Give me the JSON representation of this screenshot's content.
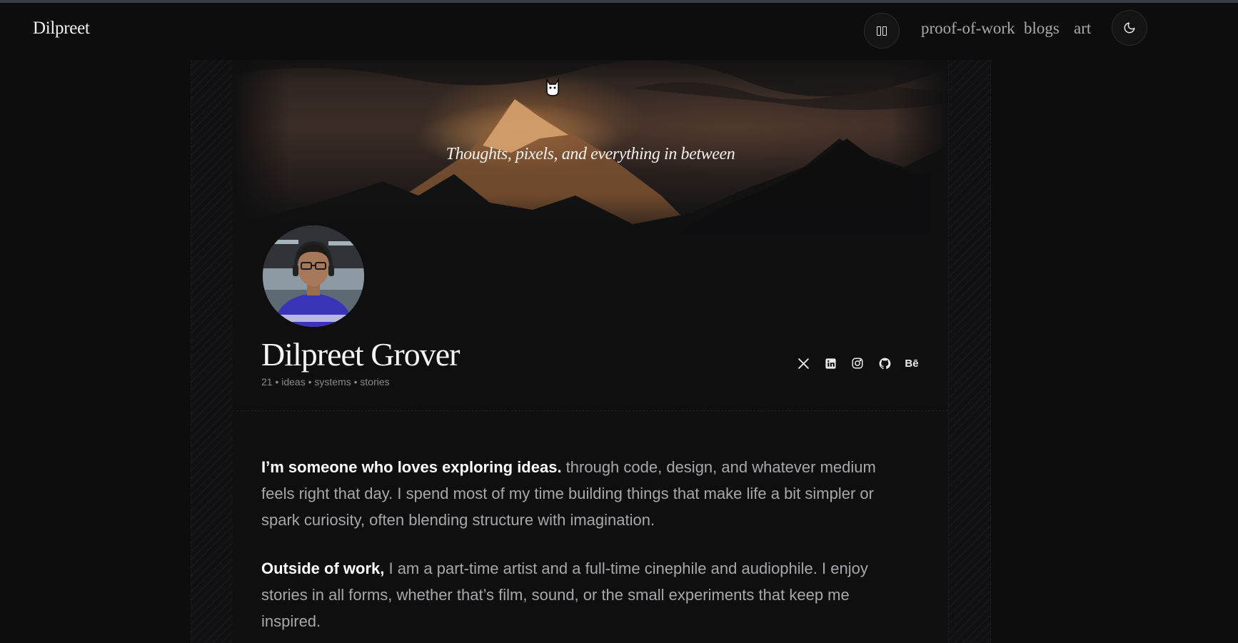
{
  "header": {
    "brand": "Dilpreet",
    "nav": [
      {
        "label": "proof-of-work"
      },
      {
        "label": "blogs"
      },
      {
        "label": "art"
      }
    ],
    "icons": {
      "music_toggle": "pause-icon",
      "theme_toggle": "moon-icon"
    }
  },
  "hero": {
    "tagline": "Thoughts, pixels, and everything in between"
  },
  "profile": {
    "name": "Dilpreet Grover",
    "meta": "21 • ideas • systems • stories",
    "socials": [
      {
        "icon": "x-icon",
        "label": "X"
      },
      {
        "icon": "linkedin-icon",
        "label": "LinkedIn"
      },
      {
        "icon": "instagram-icon",
        "label": "Instagram"
      },
      {
        "icon": "github-icon",
        "label": "GitHub"
      },
      {
        "icon": "behance-icon",
        "label": "Bē"
      }
    ]
  },
  "about": {
    "p1_lead": "I’m someone who loves exploring ideas.",
    "p1_rest": " through code, design, and whatever medium feels right that day. I spend most of my time building things that make life a bit simpler or spark curiosity, often blending structure with imagination.",
    "p2_lead": "Outside of work,",
    "p2_rest": " I am a part-time artist and a full-time cinephile and audiophile. I enjoy stories in all forms, whether that’s film, sound, or the small experiments that keep me inspired."
  },
  "colors": {
    "background": "#0d0d0e",
    "text_primary": "#f4f4f4",
    "text_muted": "#a8a8ac"
  }
}
